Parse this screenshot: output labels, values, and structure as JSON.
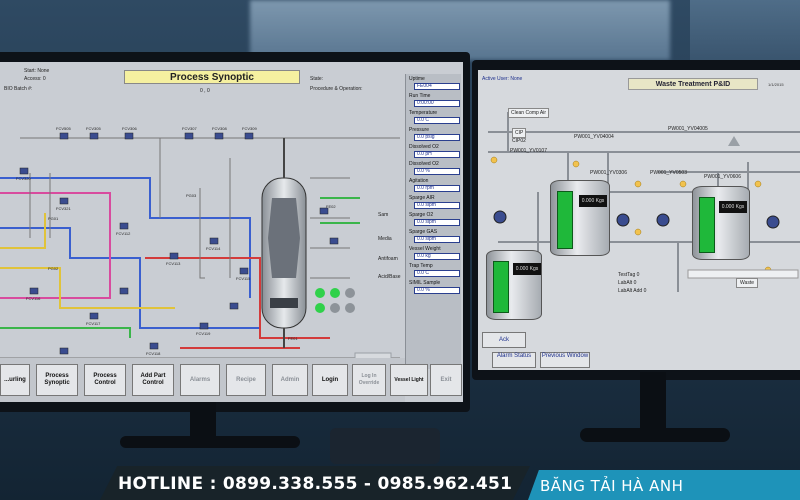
{
  "left_screen": {
    "start_label": "Start: None",
    "access_label": "Access: 0",
    "batch_label": "BIO Batch #:",
    "title": "Process Synoptic",
    "state_label": "State:",
    "procedure_label": "Procedure & Operation:",
    "counter": "0 , 0",
    "valve_labels": [
      "FCV505",
      "FCV305",
      "FCV306",
      "FCV307",
      "FCV308",
      "FCV309",
      "FCV320",
      "FCV321",
      "FCV112",
      "FCV113",
      "FCV114",
      "FCV115",
      "FCV116",
      "FCV117",
      "FCV118",
      "FCV119",
      "PG01",
      "PG02",
      "PG03",
      "FE01",
      "FE02"
    ],
    "panel": [
      {
        "label": "Uptime",
        "value": "FE004"
      },
      {
        "label": "Run Time",
        "value": "0:00:00"
      },
      {
        "label": "Temperature",
        "value": "0.0   C"
      },
      {
        "label": "Pressure",
        "value": "0.0   psig"
      },
      {
        "label": "Dissolved O2",
        "value": "0.0   pH"
      },
      {
        "label": "Dissolved O2",
        "value": "0.0   %"
      },
      {
        "label": "Agitation",
        "value": "0.0   rpm"
      },
      {
        "label": "Sparge AIR",
        "value": "0.0   slpm"
      },
      {
        "label": "Sparge O2",
        "value": "0.0   slpm"
      },
      {
        "label": "Sparge GAS",
        "value": "0.0   slpm"
      },
      {
        "label": "Vessel Weight",
        "value": "0.0   kg"
      },
      {
        "label": "Trap Temp",
        "value": "0.0   C"
      },
      {
        "label": "SIMIL Sample",
        "value": "0.0   %"
      }
    ],
    "side_labels": [
      "Sam",
      "Media",
      "Antifoam",
      "Acid/Base"
    ],
    "buttons": [
      "...urling",
      "Process Synoptic",
      "Process Control",
      "Add Part Control",
      "Alarms",
      "Recipe",
      "Admin",
      "Login",
      "Log In Override",
      "Vessel Light",
      "Exit"
    ]
  },
  "right_screen": {
    "active_user": "Active User: None",
    "title": "Waste Treatment P&ID",
    "date": "1/1/2015",
    "tags": [
      "Clean Comp Air",
      "CIP",
      "CIP02",
      "PW001_YV04004",
      "PW001_YV04005",
      "PW001_YV0107",
      "PW001_YV0306",
      "PW001_YV0503",
      "PW001_YV0606"
    ],
    "tank_readouts": [
      "0.000 Kgs",
      "0.000 Kgs",
      "0.000 Kgs"
    ],
    "info": [
      "TestTag 0",
      "LabAlt 0",
      "LabAlt Add 0"
    ],
    "waste_label": "Waste",
    "ack_label": "Ack",
    "buttons": [
      "Alarm Status",
      "Previous Window"
    ]
  },
  "footer": {
    "hotline": "HOTLINE : 0899.338.555 - 0985.962.451",
    "brand": "BĂNG TẢI HÀ ANH"
  },
  "colors": {
    "title_bg": "#f5f0a0",
    "tank_level": "#1fb83a",
    "footer_accent": "#1e93b9"
  }
}
